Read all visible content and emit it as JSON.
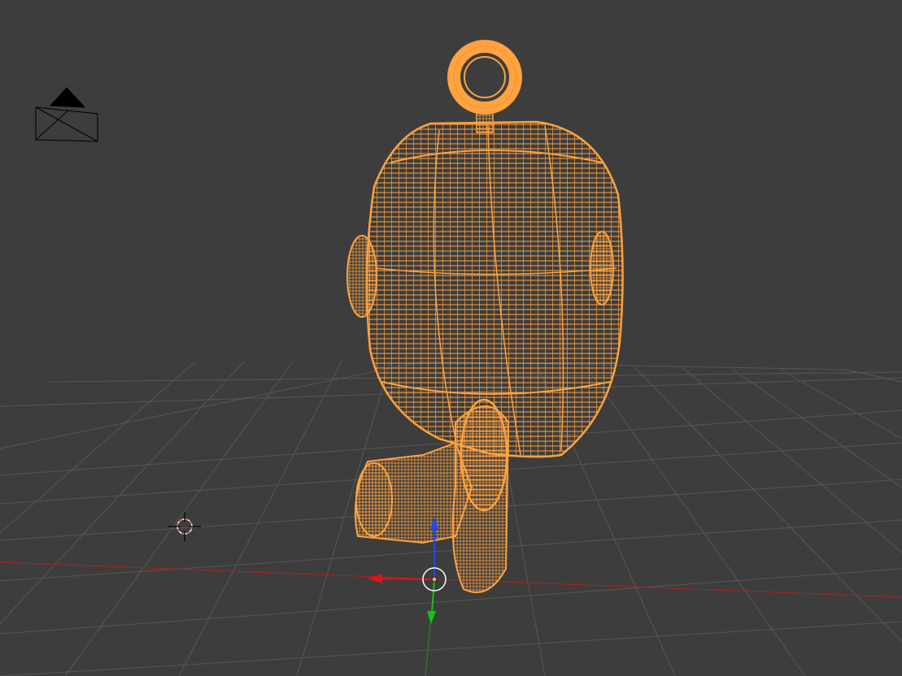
{
  "app": {
    "name": "3D Viewport",
    "mode": "wireframe"
  },
  "viewport": {
    "background_color": "#3d3d3d",
    "grid_color": "#5a5a5a",
    "axis_x_color": "#b02020",
    "axis_y_color": "#2f8a2f"
  },
  "selection": {
    "color": "#ffa23f",
    "object": "wireframe-mesh"
  },
  "gizmo": {
    "x_arrow_color": "#e01515",
    "y_arrow_color": "#18c018",
    "z_arrow_color": "#2244ff",
    "ring_color": "#ffffff"
  },
  "icons": {
    "camera": "camera-icon",
    "cursor": "3d-cursor-icon",
    "gizmo": "transform-gizmo-icon"
  }
}
